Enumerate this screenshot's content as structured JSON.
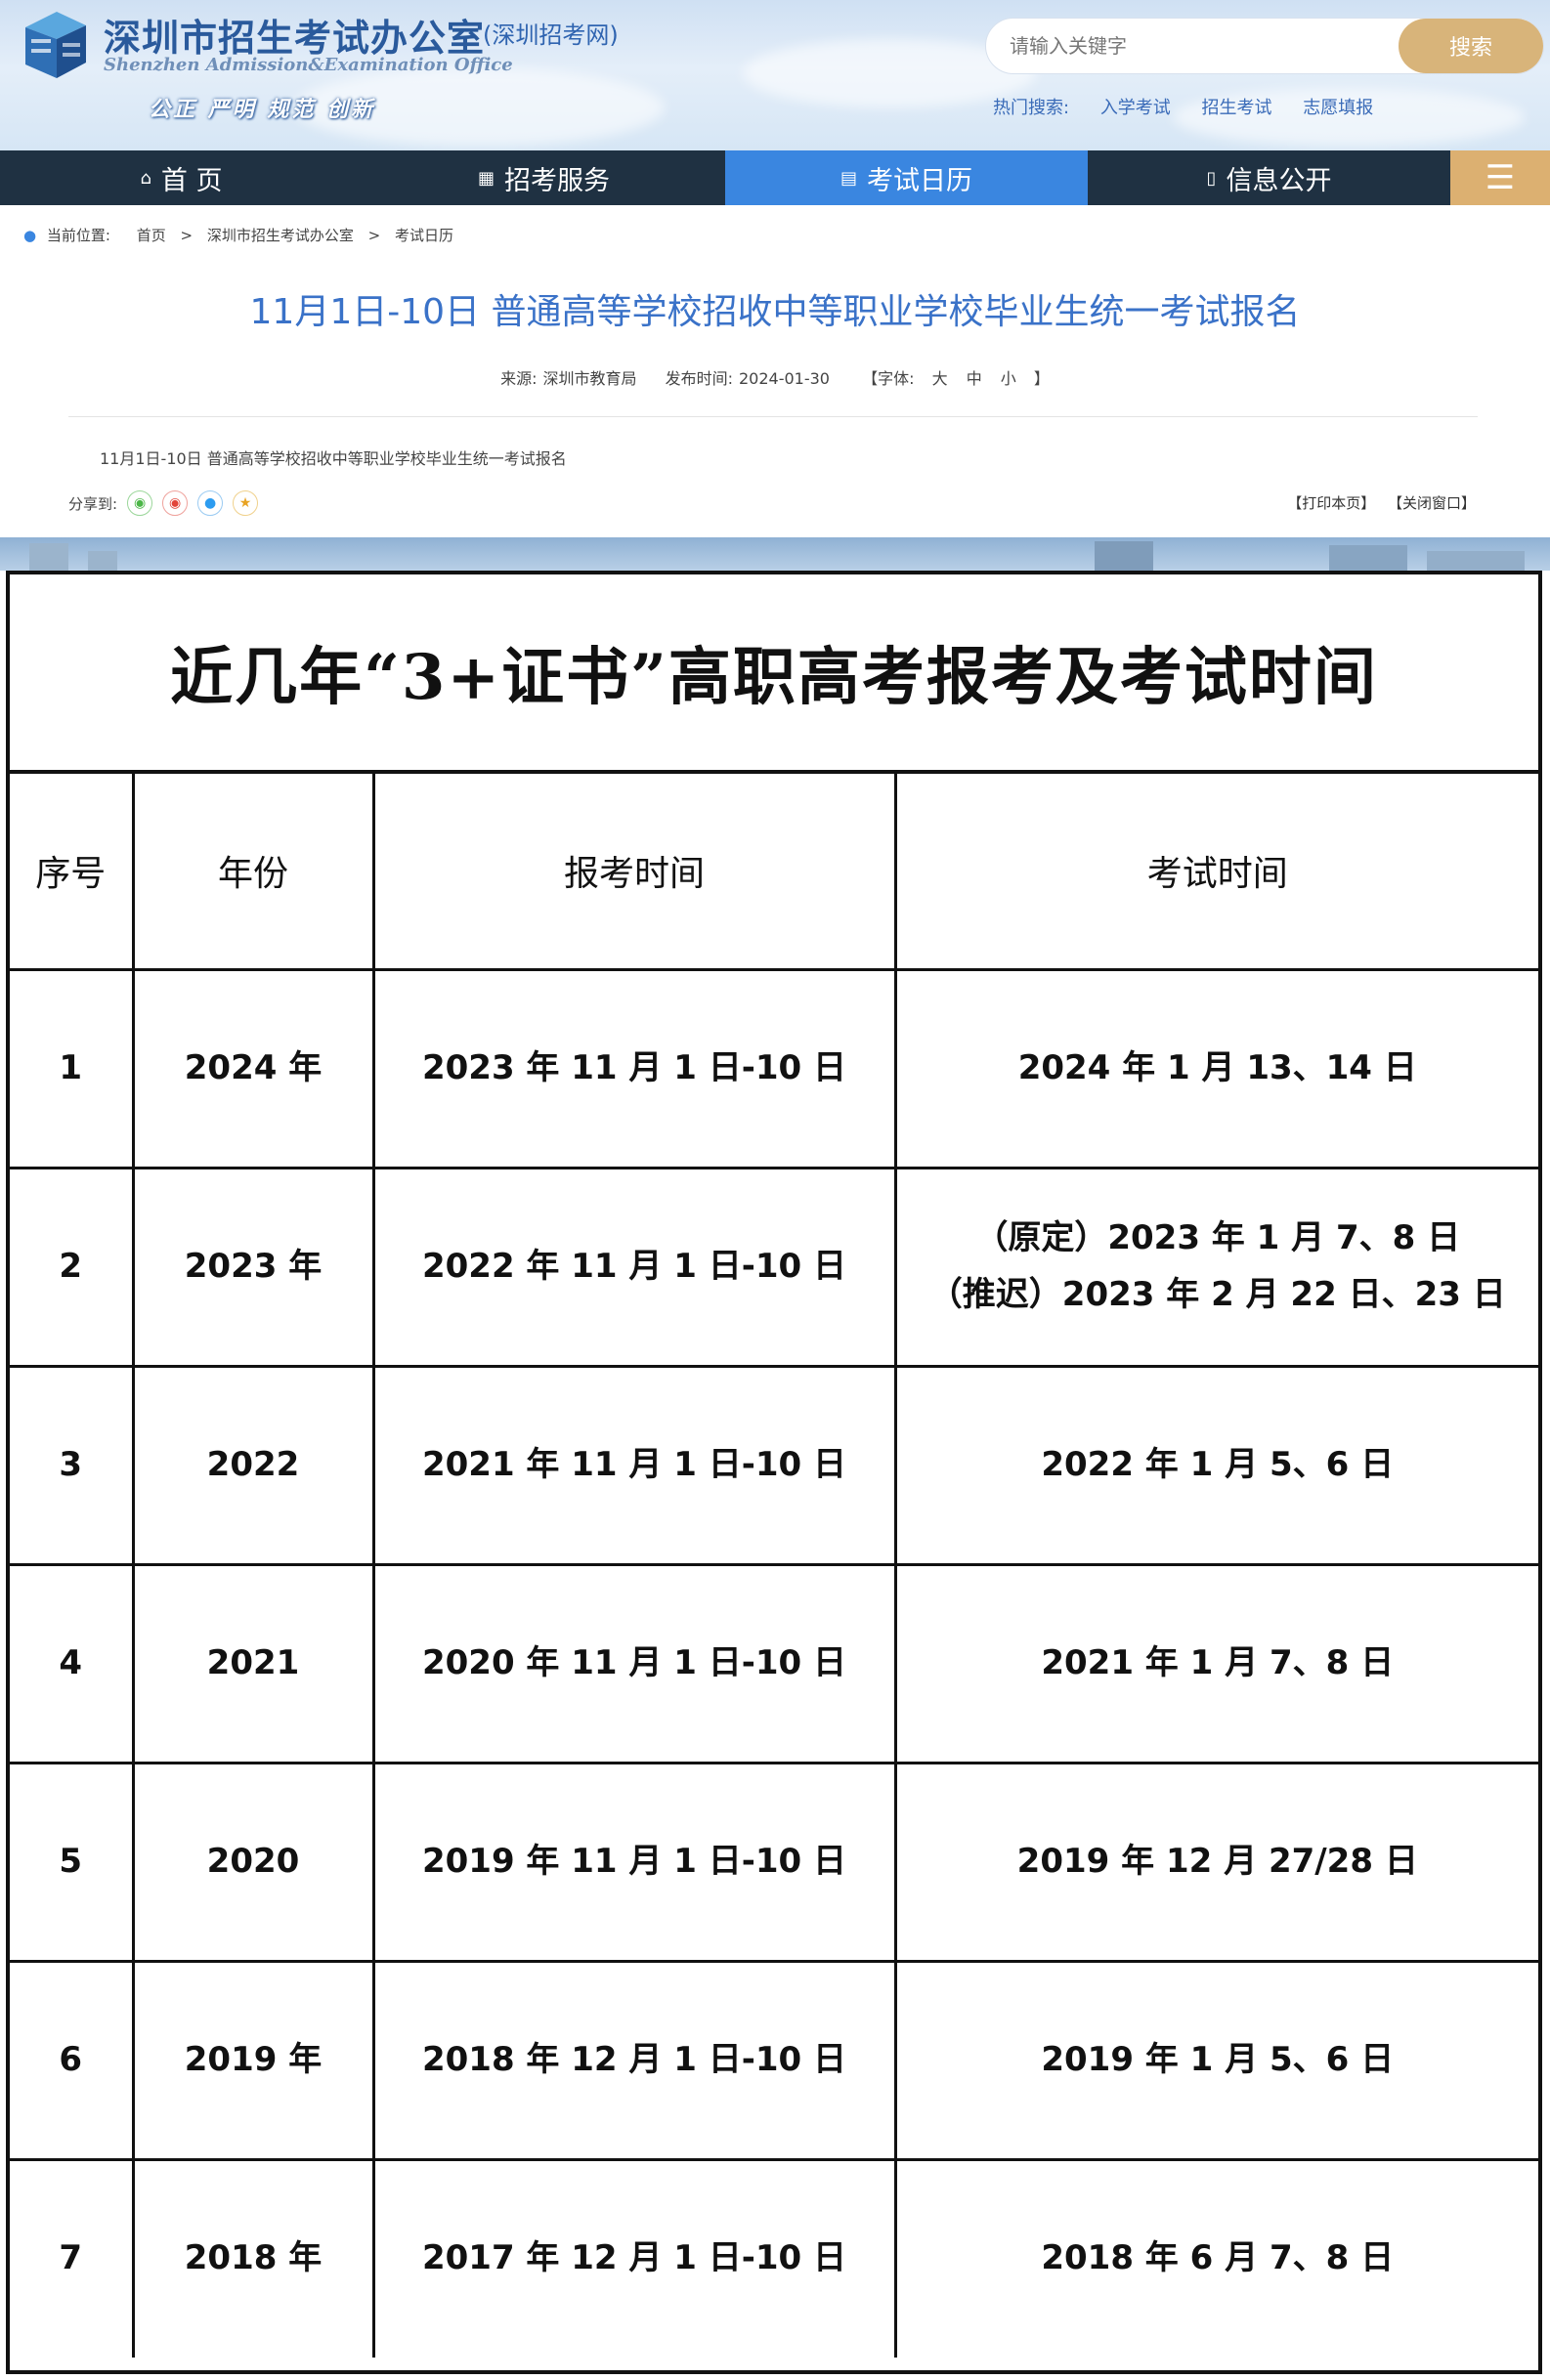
{
  "header": {
    "site_title": "深圳市招生考试办公室",
    "site_title_sub": "(深圳招考网)",
    "site_en": "Shenzhen Admission&Examination Office",
    "slogan": "公正 严明 规范 创新",
    "search_placeholder": "请输入关键字",
    "search_button": "搜索",
    "hot_label": "热门搜索:",
    "hot_links": [
      "入学考试",
      "招生考试",
      "志愿填报"
    ]
  },
  "nav": {
    "items": [
      {
        "label": "首 页",
        "icon": "home-icon"
      },
      {
        "label": "招考服务",
        "icon": "grid-icon"
      },
      {
        "label": "考试日历",
        "icon": "calendar-icon"
      },
      {
        "label": "信息公开",
        "icon": "document-icon"
      }
    ],
    "active_index": 2,
    "menu_icon": "hamburger-icon"
  },
  "breadcrumb": {
    "label": "当前位置:",
    "items": [
      "首页",
      "深圳市招生考试办公室",
      "考试日历"
    ],
    "separator": ">"
  },
  "article": {
    "title": "11月1日-10日 普通高等学校招收中等职业学校毕业生统一考试报名",
    "source_label": "来源:",
    "source": "深圳市教育局",
    "date_label": "发布时间:",
    "date": "2024-01-30",
    "font_label": "【字体:",
    "font_sizes": [
      "大",
      "中",
      "小"
    ],
    "font_end": "】",
    "summary": "11月1日-10日 普通高等学校招收中等职业学校毕业生统一考试报名",
    "share_label": "分享到:",
    "print": "【打印本页】",
    "close": "【关闭窗口】"
  },
  "schedule": {
    "title": "近几年“3+证书”高职高考报考及考试时间",
    "headers": [
      "序号",
      "年份",
      "报考时间",
      "考试时间"
    ],
    "rows": [
      [
        "1",
        "2024 年",
        "2023 年 11 月 1 日-10 日",
        "2024 年 1 月 13、14 日",
        ""
      ],
      [
        "2",
        "2023 年",
        "2022 年 11 月 1 日-10 日",
        "（原定）2023 年 1 月 7、8 日",
        "（推迟）2023 年 2 月 22 日、23 日"
      ],
      [
        "3",
        "2022",
        "2021 年 11 月 1 日-10 日",
        "2022 年 1 月 5、6 日",
        ""
      ],
      [
        "4",
        "2021",
        "2020 年 11 月 1 日-10 日",
        "2021 年 1 月 7、8 日",
        ""
      ],
      [
        "5",
        "2020",
        "2019 年 11 月 1 日-10 日",
        "2019 年 12 月 27/28 日",
        ""
      ],
      [
        "6",
        "2019 年",
        "2018 年 12 月 1 日-10 日",
        "2019 年 1 月 5、6 日",
        ""
      ],
      [
        "7",
        "2018 年",
        "2017 年 12 月 1 日-10 日",
        "2018 年 6 月 7、8 日",
        ""
      ]
    ]
  },
  "colors": {
    "nav_bg": "#1f3142",
    "nav_active": "#3a86e0",
    "accent_gold": "#d8b47a",
    "title_blue": "#3a72c8"
  }
}
